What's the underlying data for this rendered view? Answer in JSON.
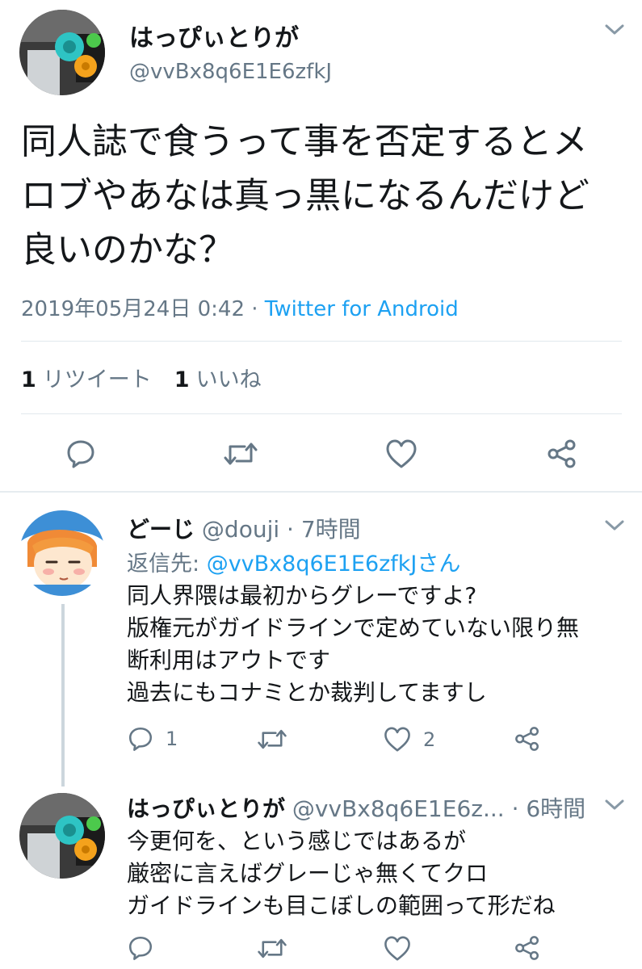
{
  "main_tweet": {
    "display_name": "はっぴぃとりが",
    "handle": "@vvBx8q6E1E6zfkJ",
    "text": "同人誌で食うって事を否定するとメ\nロブやあなは真っ黒になるんだけど\n良いのかな？",
    "timestamp": "2019年05月24日 0:42",
    "separator": " · ",
    "source": "Twitter for Android",
    "retweet_count": "1",
    "retweet_label": "リツイート",
    "like_count": "1",
    "like_label": "いいね"
  },
  "replies": [
    {
      "display_name": "どーじ",
      "handle": "@douji",
      "time": "· 7時間",
      "reply_to_label": "返信先: ",
      "reply_to_mention": "@vvBx8q6E1E6zfkJさん",
      "text": "同人界隈は最初からグレーですよ?\n版権元がガイドラインで定めていない限り無\n断利用はアウトです\n過去にもコナミとか裁判してますし",
      "reply_count": "1",
      "retweet_count": "",
      "like_count": "2"
    },
    {
      "display_name": "はっぴぃとりが",
      "handle": "@vvBx8q6E1E6z...",
      "time": "· 6時間",
      "text": "今更何を、という感じではあるが\n厳密に言えばグレーじゃ無くてクロ\nガイドラインも目こぼしの範囲って形だね",
      "reply_count": "",
      "retweet_count": "",
      "like_count": ""
    }
  ],
  "icons": {
    "menu": "chevron-down-icon",
    "reply": "reply-icon",
    "retweet": "retweet-icon",
    "like": "heart-icon",
    "share": "share-icon"
  },
  "colors": {
    "link": "#1da1f2",
    "secondary_text": "#657786",
    "primary_text": "#14171a",
    "divider": "#e6ecf0"
  }
}
